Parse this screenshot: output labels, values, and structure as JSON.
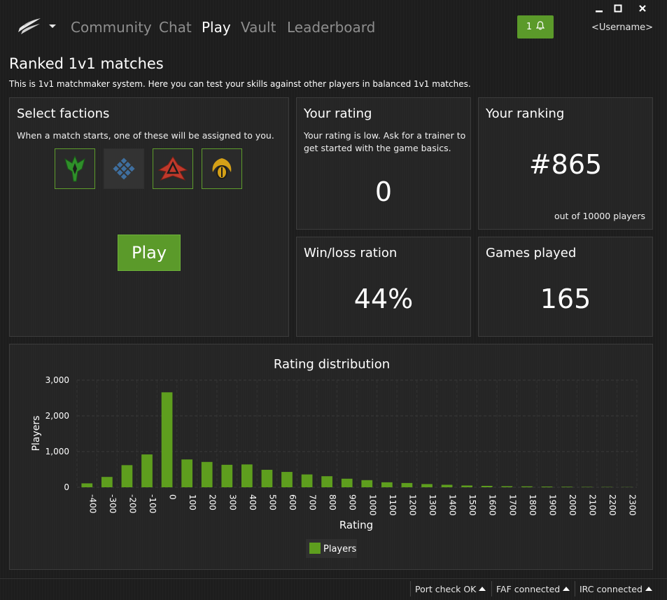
{
  "nav": {
    "items": [
      {
        "label": "Community",
        "active": false
      },
      {
        "label": "Chat",
        "active": false
      },
      {
        "label": "Play",
        "active": true
      },
      {
        "label": "Vault",
        "active": false
      },
      {
        "label": "Leaderboard",
        "active": false
      }
    ],
    "notification_count": "1",
    "username": "<Username>"
  },
  "page": {
    "title": "Ranked 1v1 matches",
    "description": "This is 1v1 matchmaker system. Here you can test your skills against other players in balanced 1v1 matches."
  },
  "factions_panel": {
    "title": "Select factions",
    "description": "When a match starts, one of these will be assigned to you.",
    "factions": [
      {
        "icon": "aeon-faction-icon",
        "color": "#2f8f2a",
        "selected": true
      },
      {
        "icon": "uef-faction-icon",
        "color": "#3f6f9f",
        "selected": false
      },
      {
        "icon": "cybran-faction-icon",
        "color": "#c0392b",
        "selected": true
      },
      {
        "icon": "seraphim-faction-icon",
        "color": "#d4a017",
        "selected": true
      }
    ],
    "play_label": "Play"
  },
  "rating_panel": {
    "title": "Your rating",
    "description": "Your rating is low. Ask for a trainer to get started with the game basics.",
    "value": "0"
  },
  "ranking_panel": {
    "title": "Your ranking",
    "value": "#865",
    "subtitle": "out of 10000 players"
  },
  "winloss_panel": {
    "title": "Win/loss ration",
    "value": "44%"
  },
  "games_panel": {
    "title": "Games played",
    "value": "165"
  },
  "chart_data": {
    "type": "bar",
    "title": "Rating distribution",
    "xlabel": "Rating",
    "ylabel": "Players",
    "ylim": [
      0,
      3000
    ],
    "yticks": [
      "0",
      "1,000",
      "2,000",
      "3,000"
    ],
    "grid": true,
    "legend": "bottom-center",
    "categories": [
      "-400",
      "-300",
      "-200",
      "-100",
      "0",
      "100",
      "200",
      "300",
      "400",
      "500",
      "600",
      "700",
      "800",
      "900",
      "1000",
      "1100",
      "1200",
      "1300",
      "1400",
      "1500",
      "1600",
      "1700",
      "1800",
      "1900",
      "2000",
      "2100",
      "2200",
      "2300"
    ],
    "series": [
      {
        "name": "Players",
        "color": "#5e9e1e",
        "values": [
          110,
          290,
          620,
          920,
          2660,
          780,
          710,
          630,
          640,
          490,
          430,
          360,
          310,
          240,
          200,
          140,
          120,
          90,
          70,
          50,
          40,
          30,
          25,
          20,
          15,
          10,
          8,
          5
        ]
      }
    ]
  },
  "status_bar": {
    "items": [
      "Port check OK",
      "FAF connected",
      "IRC connected"
    ]
  }
}
